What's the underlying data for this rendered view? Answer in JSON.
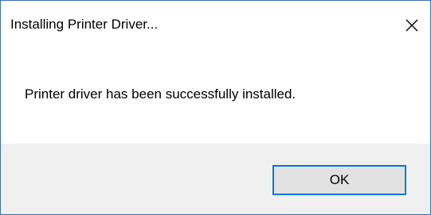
{
  "dialog": {
    "title": "Installing Printer Driver...",
    "message": "Printer driver has been successfully installed.",
    "ok_label": "OK",
    "close_icon": "close-icon"
  },
  "colors": {
    "border": "#3c6fb4",
    "footer_bg": "#f0f0f0",
    "button_bg": "#e1e1e1",
    "button_focus_border": "#0078d7"
  }
}
